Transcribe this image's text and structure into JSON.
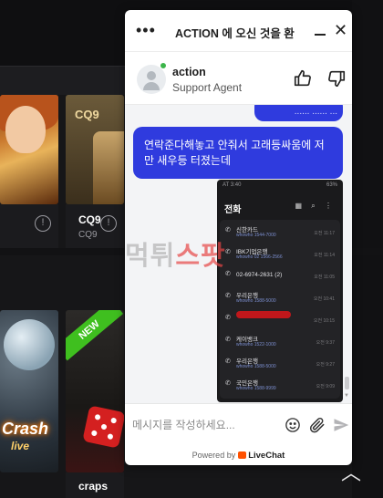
{
  "games": [
    {
      "name": "",
      "provider": ""
    },
    {
      "name": "CQ9",
      "provider": "CQ9",
      "brand": "CQ9"
    },
    {
      "name": "",
      "provider": ""
    },
    {
      "name": "craps",
      "provider": "",
      "ribbon": "NEW"
    }
  ],
  "game_art": {
    "crash_title": "Crash",
    "crash_sub": "live"
  },
  "chat": {
    "title": "ACTION 에 오신 것을 환",
    "agent_name": "action",
    "agent_role": "Support Agent",
    "previous_bubble": "...... ...... ...",
    "message": "연락준다해놓고 안줘서 고래등싸움에 저만 새우등 터졌는데",
    "composer_placeholder": "메시지를 작성하세요...",
    "powered_by": "Powered by",
    "powered_brand": "LiveChat",
    "accent_color": "#2f3bde",
    "online_color": "#3cb54a"
  },
  "screenshot": {
    "status_left": "AT 3:40",
    "status_right": "63%",
    "title": "전화",
    "calls": [
      {
        "name": "신한카드",
        "sub": "whowho 1544-7000",
        "time": "오전 11:17"
      },
      {
        "name": "IBK기업은행",
        "sub": "whowho 02 1566-2566",
        "time": "오전 11:14"
      },
      {
        "name": "02-6974-2631 (2)",
        "sub": "",
        "time": "오전 11:05"
      },
      {
        "name": "우리은행",
        "sub": "whowho 1588-5000",
        "time": "오전 10:41"
      },
      {
        "name": "",
        "sub": "",
        "time": "오전 10:15"
      },
      {
        "name": "케이뱅크",
        "sub": "whowho 1522-1000",
        "time": "오전 9:37"
      },
      {
        "name": "우리은행",
        "sub": "whowho 1588-5000",
        "time": "오전 9:27"
      },
      {
        "name": "국민은행",
        "sub": "whowho 1588-9999",
        "time": "오전 9:09"
      }
    ]
  },
  "watermark": {
    "part1": "먹튀",
    "part2": "스팟"
  }
}
